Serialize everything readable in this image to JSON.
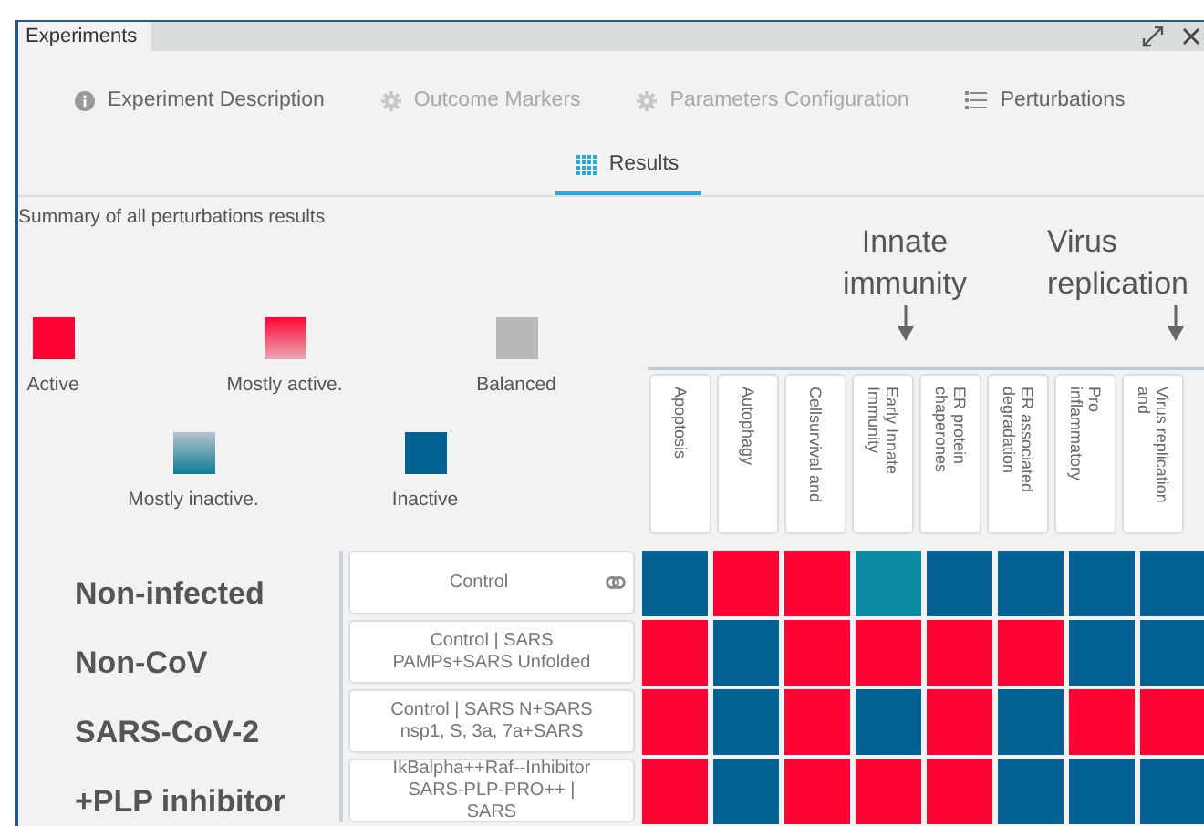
{
  "window": {
    "tab": "Experiments"
  },
  "tabs": [
    {
      "label": "Experiment Description",
      "kind": "info",
      "disabled": false,
      "selected": false
    },
    {
      "label": "Outcome Markers",
      "kind": "gear",
      "disabled": true,
      "selected": false
    },
    {
      "label": "Parameters Configuration",
      "kind": "gear",
      "disabled": true,
      "selected": false
    },
    {
      "label": "Perturbations",
      "kind": "list",
      "disabled": false,
      "selected": false
    },
    {
      "label": "Results",
      "kind": "grid",
      "disabled": false,
      "selected": true
    }
  ],
  "summary": "Summary of all perturbations results",
  "legend": [
    {
      "label": "Active",
      "kind": "active"
    },
    {
      "label": "Mostly active.",
      "kind": "mostly_active"
    },
    {
      "label": "Balanced",
      "kind": "balanced"
    },
    {
      "label": "Mostly inactive.",
      "kind": "mostly_inactive"
    },
    {
      "label": "Inactive",
      "kind": "inactive"
    }
  ],
  "annotations": [
    "Innate immunity",
    "Virus replication"
  ],
  "columns": [
    "Apoptosis",
    "Autophagy",
    "Cellsurvival and",
    "Early Innate Immunity",
    "ER protein chaperones",
    "ER associated degradation",
    "Pro inflammatory",
    "Virus replication and"
  ],
  "rows": [
    {
      "group": "Non-infected",
      "perturbation": "Control",
      "linked": true,
      "cells": [
        {
          "kind": "inactive"
        },
        {
          "kind": "active"
        },
        {
          "kind": "active"
        },
        {
          "kind": "mostly_inactive"
        },
        {
          "kind": "inactive"
        },
        {
          "kind": "inactive"
        },
        {
          "kind": "inactive"
        },
        {
          "kind": "inactive"
        }
      ]
    },
    {
      "group": "Non-CoV",
      "perturbation": "Control | SARS PAMPs+SARS Unfolded",
      "linked": false,
      "cells": [
        {
          "kind": "active"
        },
        {
          "kind": "inactive"
        },
        {
          "kind": "active"
        },
        {
          "kind": "active"
        },
        {
          "kind": "active"
        },
        {
          "kind": "active"
        },
        {
          "kind": "inactive"
        },
        {
          "kind": "inactive"
        }
      ]
    },
    {
      "group": "SARS-CoV-2",
      "perturbation": "Control | SARS N+SARS nsp1, S, 3a, 7a+SARS",
      "linked": false,
      "cells": [
        {
          "kind": "active"
        },
        {
          "kind": "inactive"
        },
        {
          "kind": "active"
        },
        {
          "kind": "inactive"
        },
        {
          "kind": "active"
        },
        {
          "kind": "inactive"
        },
        {
          "kind": "active"
        },
        {
          "kind": "active"
        }
      ]
    },
    {
      "group": "+PLP inhibitor",
      "perturbation": "IkBalpha++Raf--Inhibitor SARS-PLP-PRO++ | SARS",
      "linked": false,
      "cells": [
        {
          "kind": "active"
        },
        {
          "kind": "inactive"
        },
        {
          "kind": "active"
        },
        {
          "kind": "active"
        },
        {
          "kind": "active"
        },
        {
          "kind": "inactive"
        },
        {
          "kind": "inactive"
        },
        {
          "kind": "inactive"
        }
      ]
    }
  ]
}
